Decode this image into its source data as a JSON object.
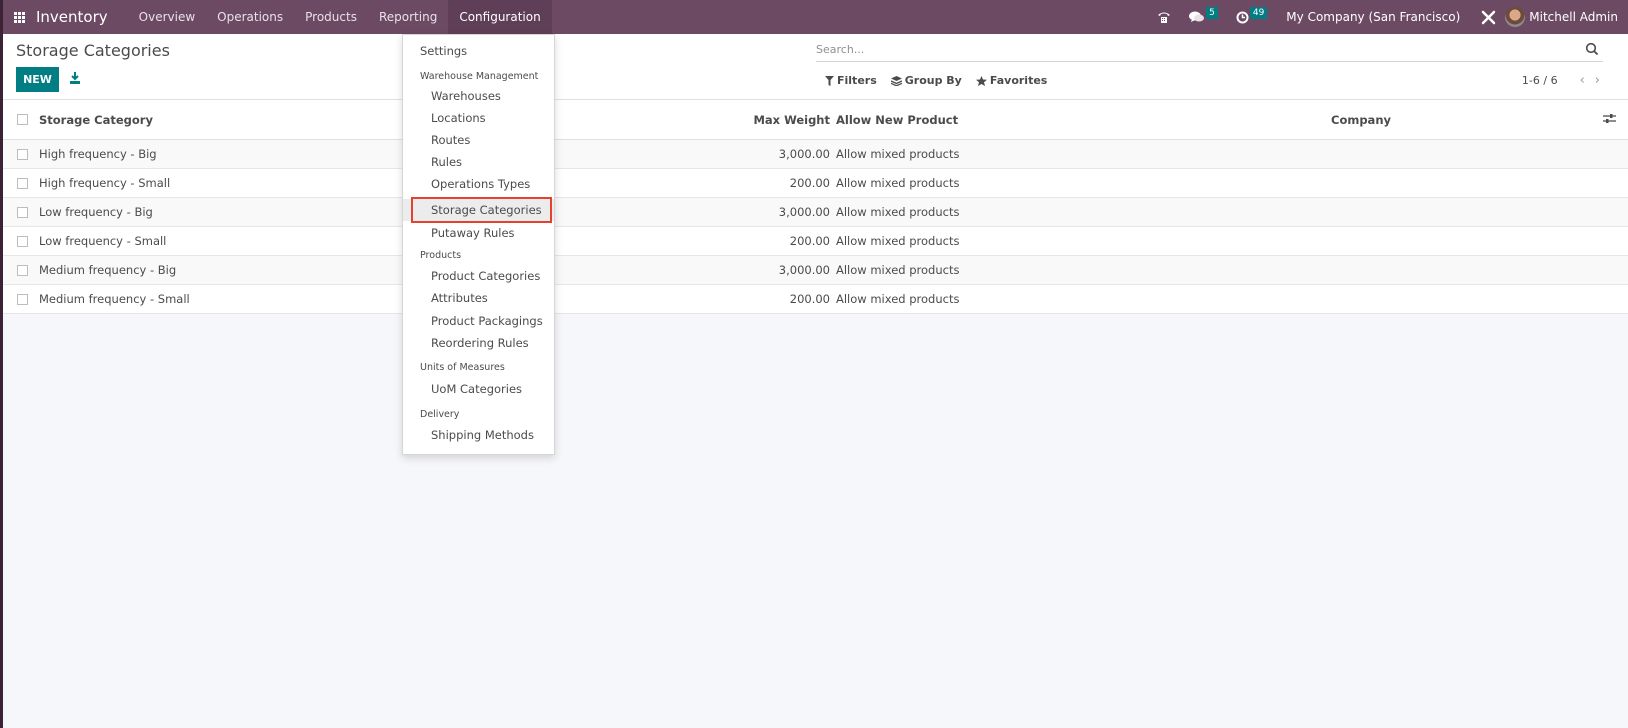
{
  "navbar": {
    "app_name": "Inventory",
    "menu": [
      "Overview",
      "Operations",
      "Products",
      "Reporting",
      "Configuration"
    ],
    "active_menu": "Configuration",
    "messages_count": "5",
    "activities_count": "49",
    "company": "My Company (San Francisco)",
    "user": "Mitchell Admin"
  },
  "control_panel": {
    "title": "Storage Categories",
    "new_label": "NEW",
    "search_placeholder": "Search...",
    "filters_label": "Filters",
    "group_by_label": "Group By",
    "favorites_label": "Favorites",
    "pager": "1-6 / 6"
  },
  "table": {
    "columns": {
      "name": "Storage Category",
      "max_weight": "Max Weight",
      "allow_new_product": "Allow New Product",
      "company": "Company"
    },
    "rows": [
      {
        "name": "High frequency - Big",
        "max_weight": "3,000.00",
        "allow": "Allow mixed products",
        "company": ""
      },
      {
        "name": "High frequency - Small",
        "max_weight": "200.00",
        "allow": "Allow mixed products",
        "company": ""
      },
      {
        "name": "Low frequency - Big",
        "max_weight": "3,000.00",
        "allow": "Allow mixed products",
        "company": ""
      },
      {
        "name": "Low frequency - Small",
        "max_weight": "200.00",
        "allow": "Allow mixed products",
        "company": ""
      },
      {
        "name": "Medium frequency - Big",
        "max_weight": "3,000.00",
        "allow": "Allow mixed products",
        "company": ""
      },
      {
        "name": "Medium frequency - Small",
        "max_weight": "200.00",
        "allow": "Allow mixed products",
        "company": ""
      }
    ]
  },
  "config_menu": {
    "settings": "Settings",
    "sections": [
      {
        "header": "Warehouse Management",
        "items": [
          "Warehouses",
          "Locations",
          "Routes",
          "Rules",
          "Operations Types",
          "Storage Categories",
          "Putaway Rules"
        ]
      },
      {
        "header": "Products",
        "items": [
          "Product Categories",
          "Attributes",
          "Product Packagings",
          "Reordering Rules"
        ]
      },
      {
        "header": "Units of Measures",
        "items": [
          "UoM Categories"
        ]
      },
      {
        "header": "Delivery",
        "items": [
          "Shipping Methods"
        ]
      }
    ],
    "selected_item": "Storage Categories"
  },
  "colors": {
    "navbar": "#6c4a64",
    "primary": "#017e84",
    "highlight": "#e4412f"
  }
}
